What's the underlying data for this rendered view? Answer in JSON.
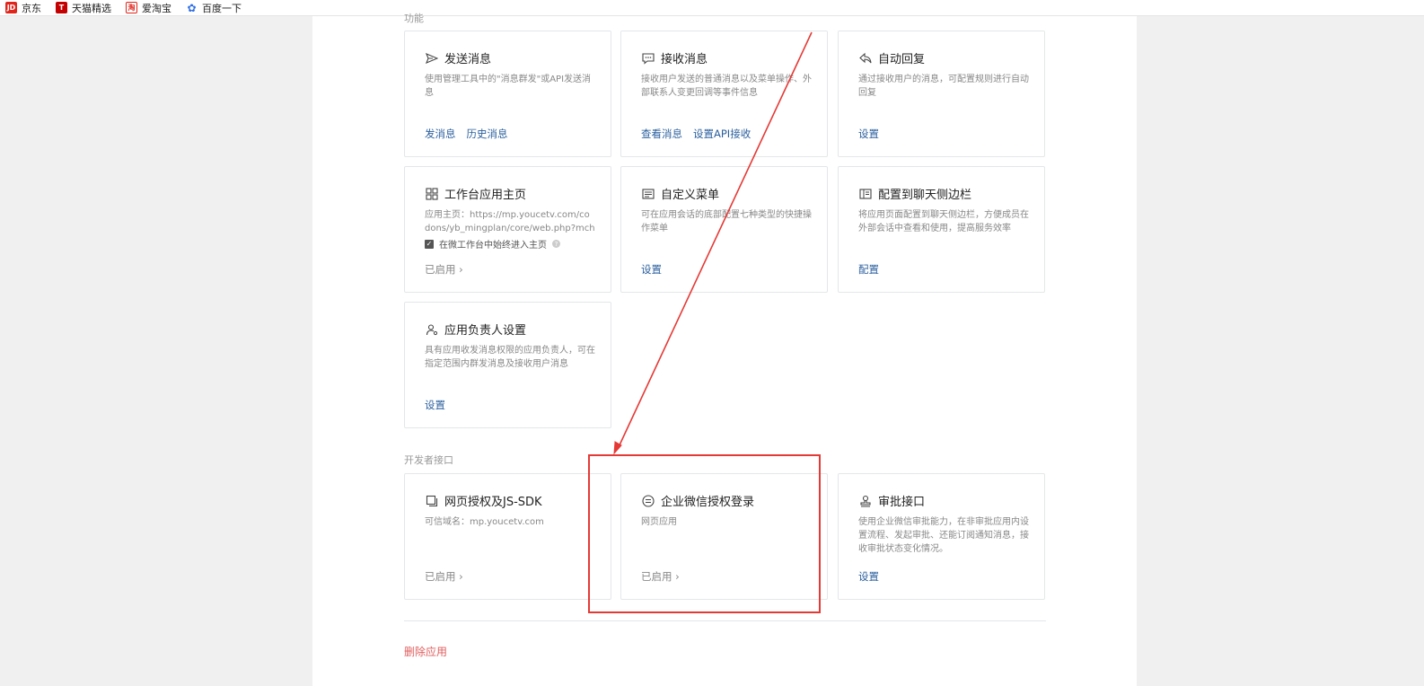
{
  "bookmarks": [
    {
      "icon": "JD",
      "label": "京东"
    },
    {
      "icon": "T",
      "label": "天猫精选"
    },
    {
      "icon": "淘",
      "label": "爱淘宝"
    },
    {
      "icon": "✿",
      "label": "百度一下"
    }
  ],
  "sections": {
    "features_label": "功能",
    "dev_label": "开发者接口"
  },
  "cards": {
    "send": {
      "title": "发送消息",
      "desc": "使用管理工具中的\"消息群发\"或API发送消息",
      "link1": "发消息",
      "link2": "历史消息"
    },
    "receive": {
      "title": "接收消息",
      "desc": "接收用户发送的普通消息以及菜单操作、外部联系人变更回调等事件信息",
      "link1": "查看消息",
      "link2": "设置API接收"
    },
    "autoreply": {
      "title": "自动回复",
      "desc": "通过接收用户的消息，可配置规则进行自动回复",
      "link1": "设置"
    },
    "homepage": {
      "title": "工作台应用主页",
      "desc": "应用主页：https://mp.youcetv.com/codons/yb_mingplan/core/web.php?mch_id=",
      "check_label": "在微工作台中始终进入主页",
      "status": "已启用 ›"
    },
    "menu": {
      "title": "自定义菜单",
      "desc": "可在应用会话的底部配置七种类型的快捷操作菜单",
      "link1": "设置"
    },
    "sidebar": {
      "title": "配置到聊天侧边栏",
      "desc": "将应用页面配置到聊天侧边栏，方便成员在外部会话中查看和使用，提高服务效率",
      "link1": "配置"
    },
    "owner": {
      "title": "应用负责人设置",
      "desc": "具有应用收发消息权限的应用负责人，可在指定范围内群发消息及接收用户消息",
      "link1": "设置"
    },
    "jssdk": {
      "title": "网页授权及JS-SDK",
      "desc": "可信域名：mp.youcetv.com",
      "status": "已启用 ›"
    },
    "oauth": {
      "title": "企业微信授权登录",
      "desc": "网页应用",
      "status": "已启用 ›"
    },
    "approval": {
      "title": "审批接口",
      "desc": "使用企业微信审批能力，在非审批应用内设置流程、发起审批、还能订阅通知消息，接收审批状态变化情况。",
      "link1": "设置"
    }
  },
  "delete_label": "删除应用",
  "colors": {
    "link": "#2b5f9e",
    "danger": "#e15e5e",
    "annotation": "#e53935"
  }
}
